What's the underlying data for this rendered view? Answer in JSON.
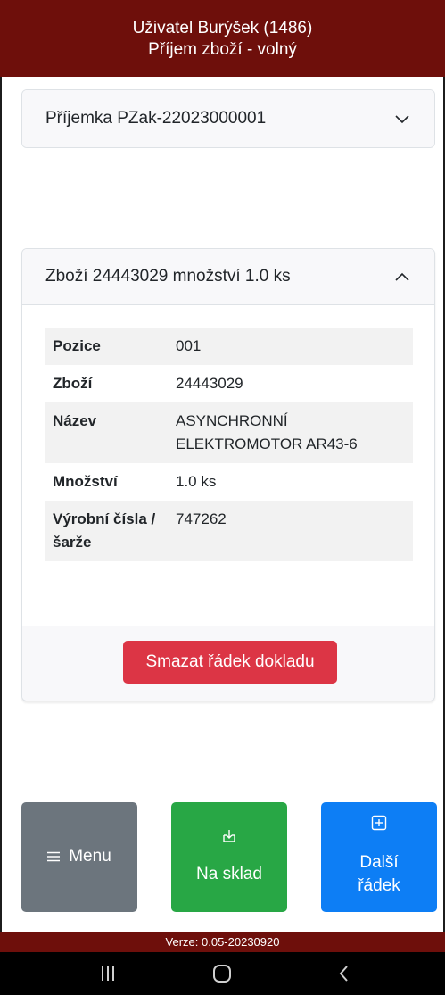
{
  "header": {
    "user": "Uživatel Burýšek (1486)",
    "title": "Příjem zboží - volný"
  },
  "receipt_panel": {
    "label": "Příjemka PZak-22023000001",
    "expanded": false
  },
  "item_panel": {
    "label": "Zboží 24443029 množství 1.0 ks",
    "expanded": true,
    "rows": [
      {
        "label": "Pozice",
        "value": "001"
      },
      {
        "label": "Zboží",
        "value": "24443029"
      },
      {
        "label": "Název",
        "value": "ASYNCHRONNÍ ELEKTROMOTOR AR43-6"
      },
      {
        "label": "Množství",
        "value": "1.0 ks"
      },
      {
        "label": "Výrobní čísla / šarže",
        "value": "747262"
      }
    ],
    "delete_label": "Smazat řádek dokladu"
  },
  "bottom_buttons": {
    "menu_label": "Menu",
    "stock_label": "Na sklad",
    "next_label": "Další řádek"
  },
  "version": "Verze: 0.05-20230920",
  "icons": {
    "menu": "hamburger-icon",
    "stock": "box-arrow-in-down-icon",
    "next": "plus-square-icon"
  },
  "colors": {
    "header_bg": "#6e0f0b",
    "danger": "#dc3545",
    "secondary": "#6c757d",
    "success": "#28a745",
    "primary": "#0d7ef5"
  }
}
